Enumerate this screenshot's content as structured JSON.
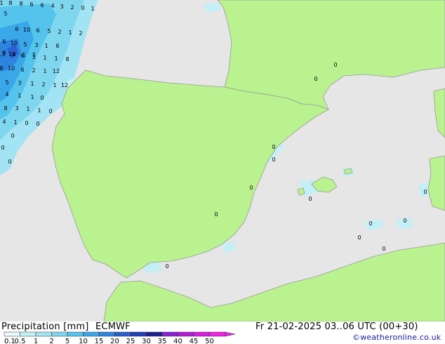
{
  "legend": {
    "title": "Precipitation [mm]",
    "model": "ECMWF",
    "valid": "Fr 21-02-2025 03..06 UTC (00+30)",
    "credit": "©weatheronline.co.uk",
    "scale": [
      {
        "label": "0.1",
        "color": "#eaf9fb"
      },
      {
        "label": "0.5",
        "color": "#c3eff7"
      },
      {
        "label": "1",
        "color": "#a2e4f3"
      },
      {
        "label": "2",
        "color": "#7fd6ef"
      },
      {
        "label": "5",
        "color": "#55c4ec"
      },
      {
        "label": "10",
        "color": "#3aa7e8"
      },
      {
        "label": "15",
        "color": "#2d84de"
      },
      {
        "label": "20",
        "color": "#2b5fcf"
      },
      {
        "label": "25",
        "color": "#233eb8"
      },
      {
        "label": "30",
        "color": "#1d1f95"
      },
      {
        "label": "35",
        "color": "#8a1fd1"
      },
      {
        "label": "40",
        "color": "#b41ad8"
      },
      {
        "label": "45",
        "color": "#d71ce0"
      },
      {
        "label": "50",
        "color": "#ee22e8"
      }
    ]
  },
  "colors": {
    "sea": "#e6e6e6",
    "land": "#b9f28f",
    "coast": "#9a9a9a"
  },
  "values": [
    "1",
    "8",
    "8",
    "6",
    "6",
    "4",
    "3",
    "2",
    "0",
    "1",
    "5",
    "6",
    "10",
    "6",
    "5",
    "2",
    "1",
    "2",
    "6",
    "10",
    "5",
    "3",
    "1",
    "6",
    "8",
    "2",
    "1",
    "7",
    "13",
    "16",
    "6",
    "3",
    "1",
    "1",
    "8",
    "8",
    "10",
    "6",
    "2",
    "1",
    "12",
    "5",
    "3",
    "1",
    "2",
    "1",
    "12",
    "4",
    "1",
    "1",
    "0",
    "8",
    "3",
    "1",
    "1",
    "0",
    "4",
    "1",
    "0",
    "0",
    "0",
    "0",
    "0",
    "0",
    "0",
    "0",
    "0",
    "0",
    "0",
    "0",
    "0",
    "0",
    "0",
    "0",
    "0",
    "0"
  ]
}
